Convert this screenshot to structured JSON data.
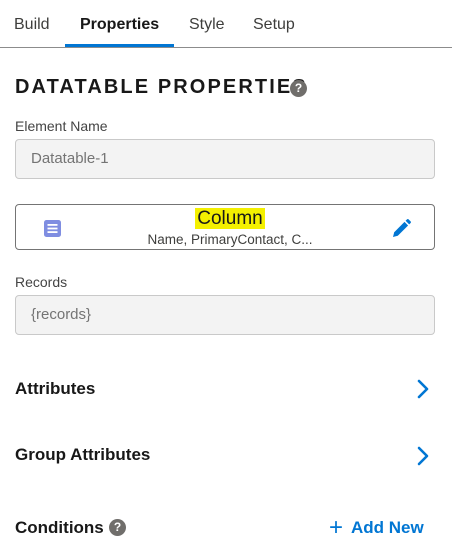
{
  "tabs": [
    {
      "label": "Build",
      "active": false
    },
    {
      "label": "Properties",
      "active": true
    },
    {
      "label": "Style",
      "active": false
    },
    {
      "label": "Setup",
      "active": false
    }
  ],
  "section": {
    "title": "DATATABLE PROPERTIES",
    "help_icon": "question-circle-icon"
  },
  "element_name": {
    "label": "Element Name",
    "value": "Datatable-1"
  },
  "column": {
    "title": "Column",
    "subtitle": "Name, PrimaryContact, C...",
    "icon": "list-icon",
    "edit_icon": "pencil-icon"
  },
  "records": {
    "label": "Records",
    "value": "{records}"
  },
  "attributes": {
    "label": "Attributes"
  },
  "group_attributes": {
    "label": "Group Attributes"
  },
  "conditions": {
    "label": "Conditions",
    "add_new": "Add New",
    "help_icon": "question-circle-icon"
  },
  "colors": {
    "accent": "#0176d3",
    "highlight": "#f4f000",
    "list_icon": "#7f8de1"
  }
}
